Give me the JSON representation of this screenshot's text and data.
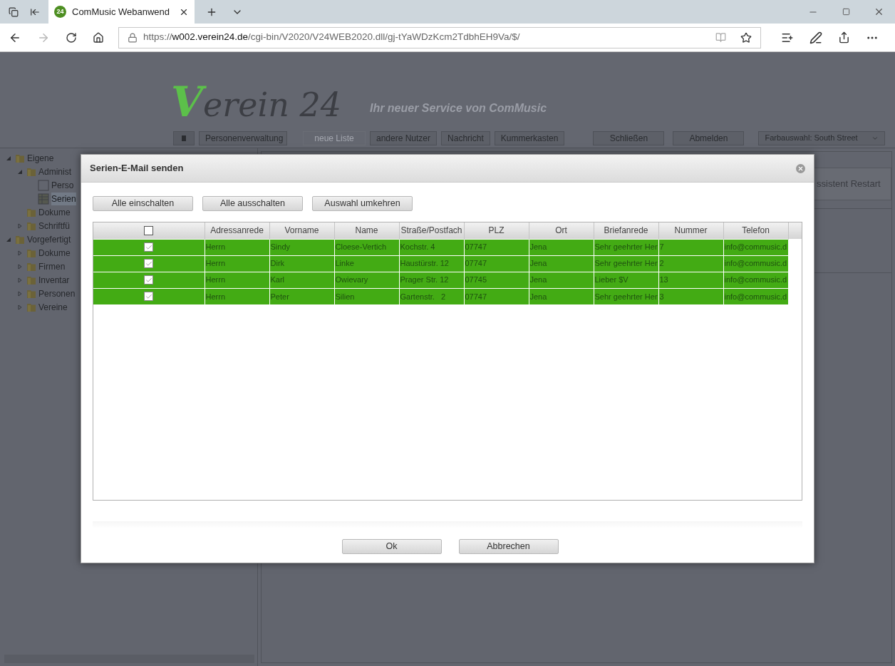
{
  "browser": {
    "tab": {
      "favicon": "24",
      "title": "ComMusic Webanwend"
    },
    "url": [
      "https://",
      "w002.verein24.de",
      "/cgi-bin/V2020/V24WEB2020.dll/gj-tYaWDzKcm2TdbhEH9Va/$/"
    ]
  },
  "header": {
    "logo": "Verein 24",
    "tagline": "Ihr neuer Service von ComMusic"
  },
  "toolbar": [
    {
      "label": "Personenverwaltung",
      "disabled": false
    },
    {
      "label": "neue Liste",
      "disabled": true
    },
    {
      "label": "andere Nutzer",
      "disabled": false
    },
    {
      "label": "Nachricht",
      "disabled": false
    },
    {
      "label": "Kummerkasten",
      "disabled": false
    }
  ],
  "toolbar_right": [
    "Schließen",
    "Abmelden"
  ],
  "theme_select": "Farbauswahl: South Street",
  "tree": [
    {
      "label": "Eigene",
      "kind": "branch",
      "expanded": true,
      "selected": false,
      "children": [
        {
          "label": "Administ",
          "kind": "branch",
          "expanded": true,
          "selected": false,
          "children": [
            {
              "label": "Perso",
              "kind": "page",
              "selected": false
            },
            {
              "label": "Serien",
              "kind": "sheet",
              "selected": true
            }
          ]
        },
        {
          "label": "Dokume",
          "kind": "folder",
          "selected": false
        },
        {
          "label": "Schriftfü",
          "kind": "branch",
          "expanded": false,
          "selected": false
        }
      ]
    },
    {
      "label": "Vorgefertigt",
      "kind": "branch",
      "expanded": true,
      "selected": false,
      "children": [
        {
          "label": "Dokume",
          "kind": "branch",
          "expanded": false,
          "selected": false
        },
        {
          "label": "Firmen",
          "kind": "branch",
          "expanded": false,
          "selected": false
        },
        {
          "label": "Inventar",
          "kind": "branch",
          "expanded": false,
          "selected": false
        },
        {
          "label": "Personen",
          "kind": "branch",
          "expanded": false,
          "selected": false
        },
        {
          "label": "Vereine",
          "kind": "branch",
          "expanded": false,
          "selected": false
        }
      ]
    }
  ],
  "background_button": "ssistent Restart",
  "dialog": {
    "title": "Serien-E-Mail senden",
    "actions": [
      "Alle einschalten",
      "Alle ausschalten",
      "Auswahl umkehren"
    ],
    "table": {
      "header_checked": false,
      "columns": [
        "Adressanrede",
        "Vorname",
        "Name",
        "Straße/Postfach",
        "PLZ",
        "Ort",
        "Briefanrede",
        "Nummer",
        "Telefon"
      ],
      "rows": [
        {
          "checked": true,
          "cells": [
            "Herrn",
            "Sindy",
            "Cloese-Vertich",
            "Kochstr. 4",
            "07747",
            "Jena",
            "Sehr geehrter Her",
            "7",
            "info@commusic.d"
          ]
        },
        {
          "checked": true,
          "cells": [
            "Herrn",
            "Dirk",
            "Linke",
            "Haustürstr. 12",
            "07747",
            "Jena",
            "Sehr geehrter Her",
            "2",
            "info@commusic.d"
          ]
        },
        {
          "checked": true,
          "cells": [
            "Herrn",
            "Karl",
            "Owievary",
            "Prager Str. 12",
            "07745",
            "Jena",
            "Lieber $V",
            "13",
            "info@commusic.d"
          ]
        },
        {
          "checked": true,
          "cells": [
            "Herrn",
            "Peter",
            "Silien",
            "Gartenstr.   2",
            "07747",
            "Jena",
            "Sehr geehrter Her",
            "3",
            "info@commusic.d"
          ]
        }
      ]
    },
    "buttons": [
      "Ok",
      "Abbrechen"
    ]
  }
}
